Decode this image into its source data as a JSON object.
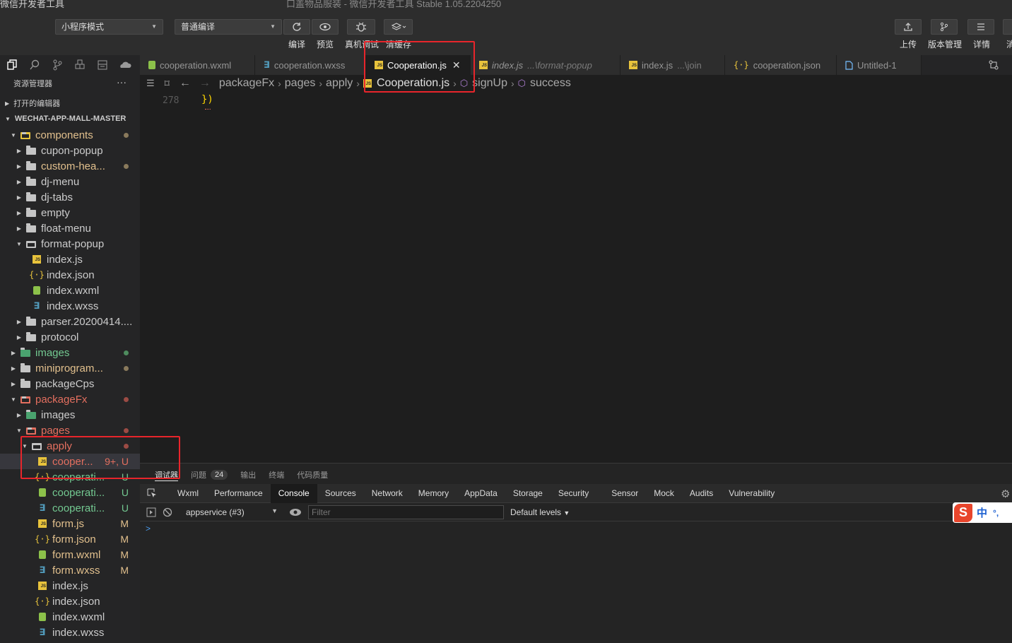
{
  "titlebar": {
    "left_text": "微信开发者工具",
    "title": "口盖物品服装 - 微信开发者工具 Stable 1.05.2204250"
  },
  "toolbar": {
    "mode_select": "小程序模式",
    "compile_select": "普通编译",
    "labels": {
      "compile": "编译",
      "preview": "预览",
      "debug": "真机调试",
      "clear_cache": "清缓存",
      "upload": "上传",
      "version": "版本管理",
      "details": "详情",
      "cut": "消"
    }
  },
  "sidebar": {
    "title": "资源管理器",
    "more": "···",
    "open_editors": "打开的编辑器",
    "project": "WECHAT-APP-MALL-MASTER",
    "tree": [
      {
        "name": "components",
        "status": "dot"
      },
      {
        "name": "cupon-popup"
      },
      {
        "name": "custom-hea...",
        "status": "dot"
      },
      {
        "name": "dj-menu"
      },
      {
        "name": "dj-tabs"
      },
      {
        "name": "empty"
      },
      {
        "name": "float-menu"
      },
      {
        "name": "format-popup"
      },
      {
        "name": "index.js"
      },
      {
        "name": "index.json"
      },
      {
        "name": "index.wxml"
      },
      {
        "name": "index.wxss"
      },
      {
        "name": "parser.20200414...."
      },
      {
        "name": "protocol"
      },
      {
        "name": "images",
        "status": "dot"
      },
      {
        "name": "miniprogram...",
        "status": "dot"
      },
      {
        "name": "packageCps"
      },
      {
        "name": "packageFx",
        "status": "dot"
      },
      {
        "name": "images"
      },
      {
        "name": "pages",
        "status": "dot"
      },
      {
        "name": "apply",
        "status": "dot"
      },
      {
        "name": "cooper...",
        "status": "9+, U"
      },
      {
        "name": "cooperati...",
        "status": "U"
      },
      {
        "name": "cooperati...",
        "status": "U"
      },
      {
        "name": "cooperati...",
        "status": "U"
      },
      {
        "name": "form.js",
        "status": "M"
      },
      {
        "name": "form.json",
        "status": "M"
      },
      {
        "name": "form.wxml",
        "status": "M"
      },
      {
        "name": "form.wxss",
        "status": "M"
      },
      {
        "name": "index.js"
      },
      {
        "name": "index.json"
      },
      {
        "name": "index.wxml"
      },
      {
        "name": "index.wxss"
      }
    ]
  },
  "tabs": [
    {
      "label": "cooperation.wxml"
    },
    {
      "label": "cooperation.wxss"
    },
    {
      "label": "Cooperation.js"
    },
    {
      "label": "index.js",
      "desc": "...\\format-popup"
    },
    {
      "label": "index.js",
      "desc": "...\\join"
    },
    {
      "label": "cooperation.json"
    },
    {
      "label": "Untitled-1"
    }
  ],
  "breadcrumb": [
    "packageFx",
    "pages",
    "apply",
    "Cooperation.js",
    "signUp",
    "success"
  ],
  "editor": {
    "line_number": "278",
    "code": "})"
  },
  "panel": {
    "tabs": [
      "调试器",
      "问题",
      "输出",
      "终端",
      "代码质量"
    ],
    "problems_count": "24",
    "devtools_tabs": [
      "Wxml",
      "Performance",
      "Console",
      "Sources",
      "Network",
      "Memory",
      "AppData",
      "Storage",
      "Security",
      "Sensor",
      "Mock",
      "Audits",
      "Vulnerability"
    ],
    "context_select": "appservice (#3)",
    "filter_placeholder": "Filter",
    "levels": "Default levels",
    "prompt": ">",
    "ime": {
      "logo": "S",
      "mode": "中",
      "punct": "°,"
    }
  }
}
